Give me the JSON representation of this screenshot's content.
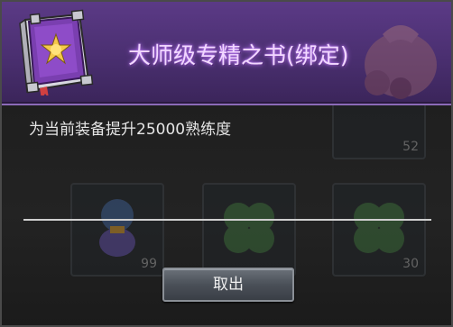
{
  "dialog": {
    "title": "大师级专精之书(绑定)",
    "description": "为当前装备提升25000熟练度",
    "cancel_label": "取出"
  },
  "background_slots": [
    {
      "count": "52"
    },
    {
      "count": "99"
    },
    {
      "count": ""
    },
    {
      "count": "30"
    }
  ],
  "colors": {
    "title_bar": "#4a2f70",
    "title_text": "#f2d8ff",
    "body": "#1f1f1f",
    "button": "#4a5058"
  }
}
